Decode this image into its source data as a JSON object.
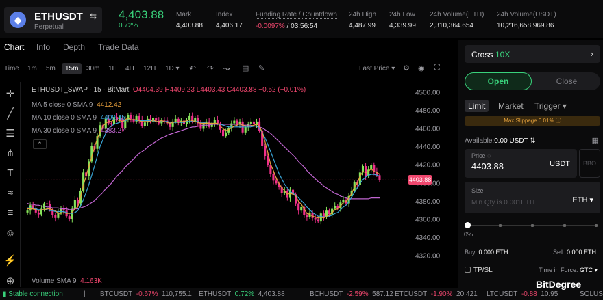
{
  "header": {
    "coin_icon": "ethereum-icon",
    "pair": "ETHUSDT",
    "pair_type": "Perpetual",
    "last_price": "4,403.88",
    "last_change": "0.72%",
    "stats": [
      {
        "label": "Mark",
        "value": "4,403.88"
      },
      {
        "label": "Index",
        "value": "4,406.17"
      },
      {
        "label": "Funding Rate / Countdown",
        "value_neg": "-0.0097%",
        "value": " / 03:56:54"
      },
      {
        "label": "24h High",
        "value": "4,487.99"
      },
      {
        "label": "24h Low",
        "value": "4,339.99"
      },
      {
        "label": "24h Volume(ETH)",
        "value": "2,310,364.654"
      },
      {
        "label": "24h Volume(USDT)",
        "value": "10,216,658,969.86"
      }
    ]
  },
  "tabs": [
    "Chart",
    "Info",
    "Depth",
    "Trade Data"
  ],
  "toolbar": {
    "time_label": "Time",
    "intervals": [
      "1m",
      "5m",
      "15m",
      "30m",
      "1H",
      "4H",
      "12H",
      "1D ▾"
    ],
    "active_interval": "15m",
    "last_price_select": "Last Price ▾"
  },
  "chart": {
    "title": "ETHUSDT_SWAP · 15 · BitMart",
    "ohlc": "O4404.39 H4409.23 L4403.43 C4403.88 −0.52 (−0.01%)",
    "ma5_label": "MA 5 close 0 SMA 9",
    "ma5_value": "4412.42",
    "ma10_label": "MA 10 close 0 SMA 9",
    "ma10_value": "4409.45",
    "ma30_label": "MA 30 close 0 SMA 9",
    "ma30_value": "4383.27",
    "current_price_tag": "4403.88",
    "volume_label": "Volume SMA 9",
    "volume_value": "4.163K",
    "colors": {
      "up": "#86e35a",
      "down": "#f0308a",
      "ma5": "#e8a03c",
      "ma10": "#3aa6d8",
      "ma30": "#c065d0"
    }
  },
  "chart_data": {
    "type": "candlestick",
    "title": "ETHUSDT_SWAP · 15 · BitMart",
    "ylim": [
      4310,
      4510
    ],
    "y_ticks": [
      "4500.00",
      "4480.00",
      "4460.00",
      "4440.00",
      "4420.00",
      "4400.00",
      "4380.00",
      "4360.00",
      "4340.00",
      "4320.00"
    ],
    "close": [
      4370,
      4376,
      4373,
      4368,
      4366,
      4372,
      4378,
      4377,
      4371,
      4365,
      4362,
      4368,
      4373,
      4370,
      4364,
      4361,
      4372,
      4382,
      4378,
      4392,
      4412,
      4408,
      4424,
      4441,
      4438,
      4452,
      4464,
      4460,
      4471,
      4466,
      4465,
      4473,
      4470,
      4472,
      4461,
      4470,
      4475,
      4471,
      4468,
      4474,
      4470,
      4463,
      4467,
      4471,
      4468,
      4472,
      4469,
      4466,
      4470,
      4469,
      4466,
      4462,
      4468,
      4471,
      4467,
      4469,
      4465,
      4470,
      4474,
      4468,
      4472,
      4466,
      4460,
      4465,
      4468,
      4462,
      4466,
      4470,
      4466,
      4459,
      4452,
      4456,
      4461,
      4466,
      4469,
      4465,
      4468,
      4456,
      4462,
      4465,
      4468,
      4465,
      4468,
      4458,
      4441,
      4430,
      4420,
      4410,
      4403,
      4400,
      4396,
      4389,
      4392,
      4384,
      4393,
      4388,
      4378,
      4370,
      4374,
      4365,
      4363,
      4368,
      4362,
      4360,
      4358,
      4367,
      4363,
      4370,
      4366,
      4372,
      4375,
      4373,
      4379,
      4382,
      4378,
      4386,
      4392,
      4401,
      4398,
      4412,
      4419,
      4408,
      4415,
      4420,
      4413,
      4409,
      4404
    ],
    "ma5": [
      4372,
      4372,
      4372,
      4371,
      4370,
      4371,
      4371,
      4372,
      4372,
      4371,
      4370,
      4367,
      4367,
      4368,
      4367,
      4367,
      4368,
      4372,
      4374,
      4385,
      4398,
      4408,
      4419,
      4429,
      4440,
      4449,
      4457,
      4463,
      4466,
      4468,
      4468,
      4470,
      4470,
      4469,
      4468,
      4470,
      4472,
      4470,
      4470,
      4470,
      4469,
      4468,
      4468,
      4468,
      4468,
      4470,
      4468,
      4468,
      4469,
      4468,
      4467,
      4466,
      4467,
      4468,
      4467,
      4468,
      4468,
      4469,
      4470,
      4469,
      4468,
      4467,
      4466,
      4466,
      4466,
      4466,
      4466,
      4466,
      4466,
      4463,
      4460,
      4458,
      4459,
      4461,
      4463,
      4464,
      4466,
      4464,
      4463,
      4463,
      4463,
      4464,
      4465,
      4463,
      4456,
      4446,
      4434,
      4421,
      4414,
      4406,
      4400,
      4395,
      4392,
      4388,
      4389,
      4388,
      4386,
      4380,
      4377,
      4372,
      4367,
      4366,
      4364,
      4363,
      4362,
      4363,
      4362,
      4364,
      4365,
      4368,
      4371,
      4372,
      4375,
      4379,
      4380,
      4384,
      4389,
      4396,
      4400,
      4408,
      4413,
      4412,
      4413,
      4416,
      4413,
      4412,
      4410
    ],
    "ma10": [
      4373,
      4373,
      4373,
      4372,
      4371,
      4371,
      4371,
      4371,
      4370,
      4370,
      4369,
      4369,
      4369,
      4369,
      4368,
      4367,
      4367,
      4368,
      4370,
      4375,
      4382,
      4390,
      4399,
      4409,
      4419,
      4430,
      4441,
      4448,
      4455,
      4460,
      4463,
      4465,
      4466,
      4467,
      4468,
      4469,
      4470,
      4470,
      4470,
      4469,
      4469,
      4469,
      4469,
      4469,
      4469,
      4469,
      4468,
      4468,
      4468,
      4468,
      4468,
      4467,
      4467,
      4467,
      4467,
      4467,
      4467,
      4468,
      4468,
      4468,
      4468,
      4468,
      4467,
      4467,
      4466,
      4466,
      4466,
      4466,
      4465,
      4465,
      4464,
      4463,
      4462,
      4462,
      4462,
      4462,
      4462,
      4462,
      4462,
      4462,
      4462,
      4463,
      4463,
      4460,
      4456,
      4450,
      4443,
      4435,
      4427,
      4419,
      4411,
      4405,
      4399,
      4395,
      4391,
      4389,
      4387,
      4384,
      4381,
      4378,
      4374,
      4371,
      4368,
      4366,
      4364,
      4364,
      4363,
      4364,
      4364,
      4365,
      4367,
      4368,
      4371,
      4374,
      4376,
      4380,
      4385,
      4390,
      4395,
      4400,
      4404,
      4407,
      4409,
      4410,
      4410,
      4409,
      4408
    ],
    "ma30": [
      4378,
      4377,
      4377,
      4376,
      4376,
      4375,
      4375,
      4374,
      4374,
      4373,
      4373,
      4373,
      4372,
      4372,
      4372,
      4371,
      4371,
      4372,
      4372,
      4373,
      4374,
      4375,
      4377,
      4379,
      4381,
      4384,
      4387,
      4390,
      4394,
      4397,
      4400,
      4404,
      4408,
      4411,
      4414,
      4418,
      4421,
      4424,
      4427,
      4430,
      4433,
      4435,
      4437,
      4440,
      4442,
      4444,
      4446,
      4448,
      4450,
      4451,
      4453,
      4454,
      4455,
      4456,
      4457,
      4458,
      4459,
      4460,
      4461,
      4462,
      4462,
      4463,
      4463,
      4464,
      4464,
      4464,
      4465,
      4465,
      4465,
      4465,
      4465,
      4465,
      4465,
      4465,
      4465,
      4465,
      4465,
      4464,
      4464,
      4464,
      4464,
      4463,
      4463,
      4462,
      4461,
      4459,
      4457,
      4455,
      4452,
      4449,
      4446,
      4443,
      4440,
      4437,
      4434,
      4431,
      4428,
      4424,
      4421,
      4418,
      4414,
      4411,
      4408,
      4405,
      4402,
      4400,
      4397,
      4395,
      4393,
      4391,
      4389,
      4388,
      4386,
      4385,
      4384,
      4383,
      4383,
      4383,
      4383,
      4383,
      4383,
      4383,
      4383,
      4384,
      4384,
      4384,
      4384
    ],
    "current_price": 4403.88
  },
  "tools": [
    "crosshair-icon",
    "trendline-icon",
    "horizontal-lines-icon",
    "pitchfork-icon",
    "text-icon",
    "pattern-icon",
    "measure-icon",
    "smile-icon",
    "ruler-icon",
    "zoom-in-icon"
  ],
  "ticker": {
    "connection": "Stable connection",
    "items": [
      {
        "sym": "BTCUSDT",
        "chg": "-0.67%",
        "price": "110,755.1",
        "dir": "n"
      },
      {
        "sym": "ETHUSDT",
        "chg": "0.72%",
        "price": "4,403.88",
        "dir": "p"
      },
      {
        "sym": "BCHUSDT",
        "chg": "-2.59%",
        "price": "587.12",
        "dir": "n"
      },
      {
        "sym": "ETCUSDT",
        "chg": "-1.90%",
        "price": "20.421",
        "dir": "n"
      },
      {
        "sym": "LTCUSDT",
        "chg": "-0.88",
        "price": "10.95",
        "dir": "n"
      },
      {
        "sym": "SOLUS",
        "chg": "",
        "price": "",
        "dir": "n"
      }
    ]
  },
  "order_panel": {
    "margin_mode": "Cross",
    "leverage": "10X",
    "open_label": "Open",
    "close_label": "Close",
    "order_types": [
      "Limit",
      "Market",
      "Trigger ▾"
    ],
    "max_slippage": "Max Slippage 0.01% ⓘ",
    "available_label": "Available:",
    "available_value": "0.00 USDT",
    "price_label": "Price ◌",
    "price_value": "4403.88",
    "price_unit": "USDT",
    "bbo_label": "BBO",
    "size_label": "Size",
    "size_placeholder": "Min Qty is 0.001ETH",
    "size_unit": "ETH ▾",
    "slider_value": "0%",
    "buy_label": "Buy",
    "buy_value": "0.000 ETH",
    "sell_label": "Sell",
    "sell_value": "0.000 ETH",
    "tpsl_label": "TP/SL",
    "tif_label": "Time in Force:",
    "tif_value": "GTC ▾"
  },
  "watermark": "BitDegree"
}
